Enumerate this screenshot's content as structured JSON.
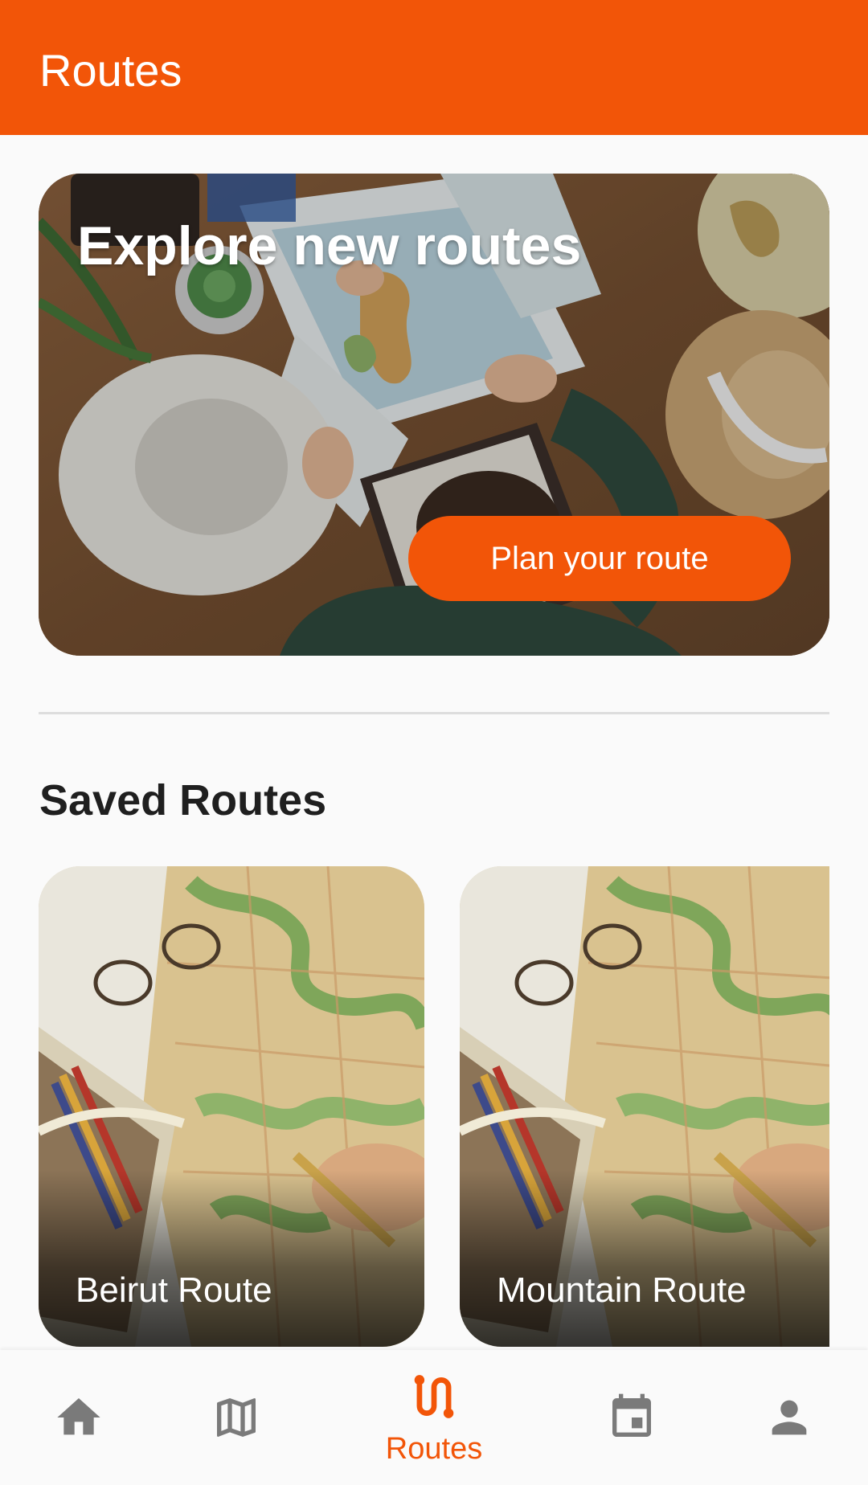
{
  "app_bar": {
    "title": "Routes"
  },
  "hero": {
    "title": "Explore new routes",
    "button_label": "Plan your route"
  },
  "saved_routes": {
    "title": "Saved Routes",
    "items": [
      {
        "name": "Beirut Route"
      },
      {
        "name": "Mountain Route"
      }
    ]
  },
  "bottom_nav": {
    "items": [
      {
        "icon": "home-icon",
        "label": "",
        "active": false
      },
      {
        "icon": "map-icon",
        "label": "",
        "active": false
      },
      {
        "icon": "route-icon",
        "label": "Routes",
        "active": true
      },
      {
        "icon": "calendar-icon",
        "label": "",
        "active": false
      },
      {
        "icon": "person-icon",
        "label": "",
        "active": false
      }
    ]
  },
  "colors": {
    "accent": "#F25508",
    "inactive_icon": "#7a7a7a",
    "background": "#fafafa"
  }
}
